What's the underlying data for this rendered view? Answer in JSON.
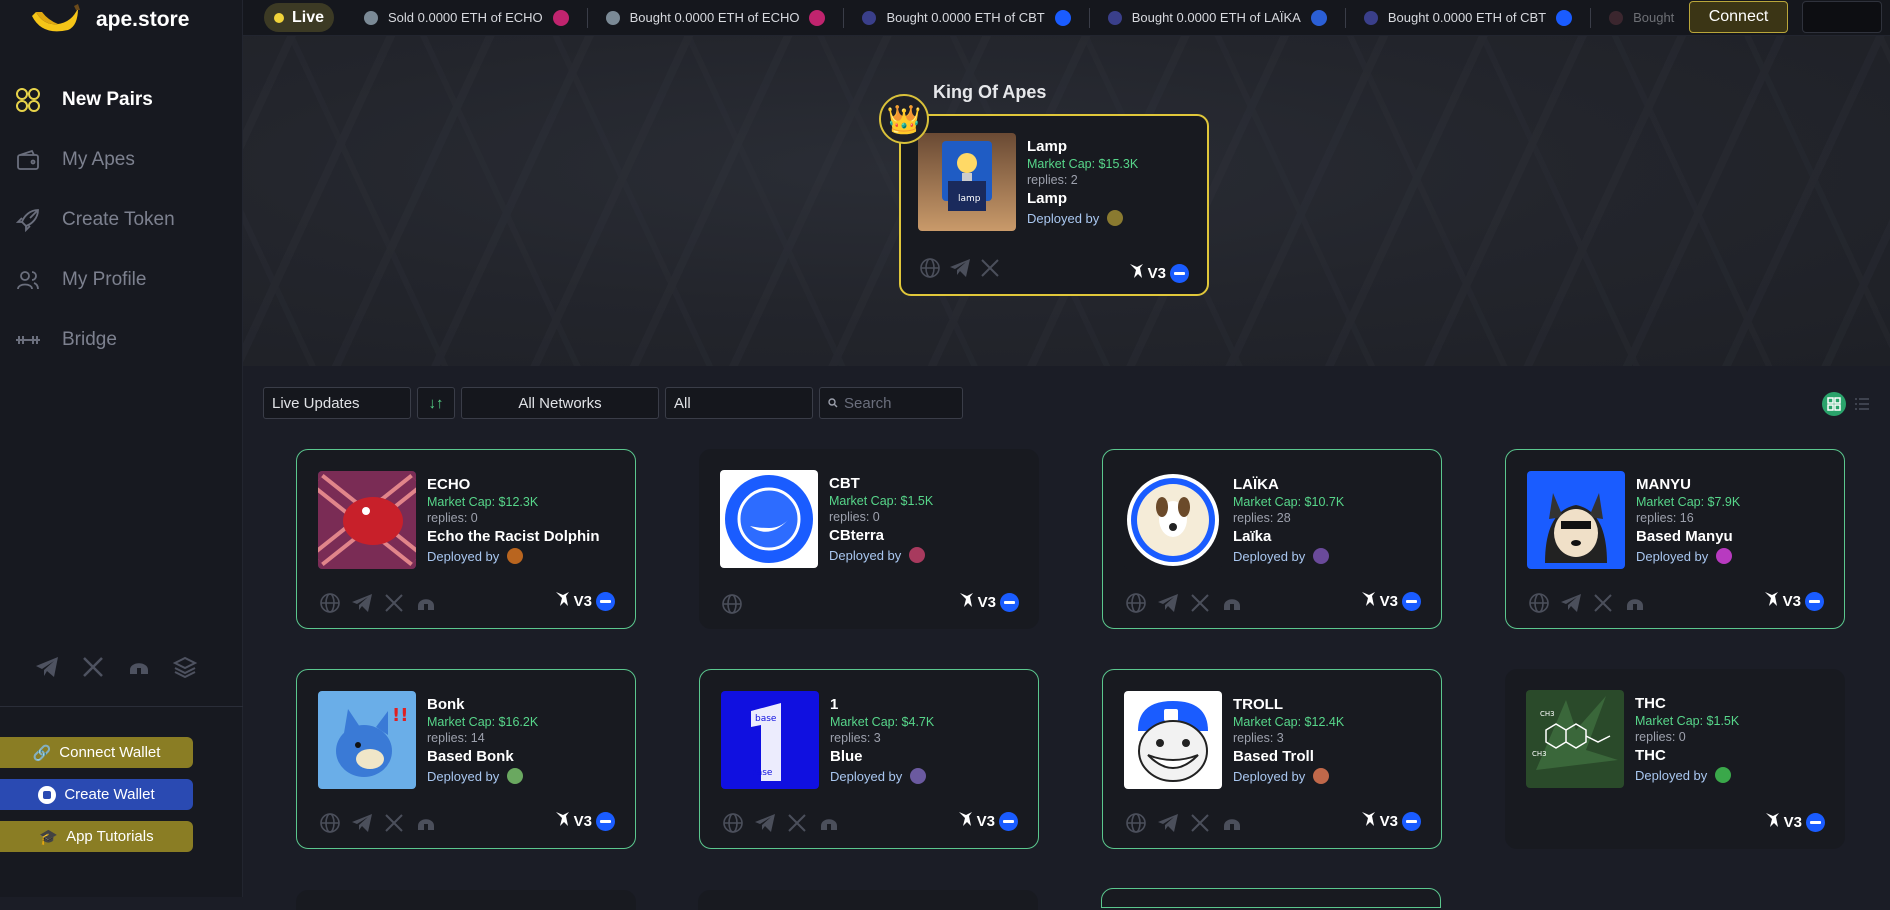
{
  "brand": {
    "name": "ape.store"
  },
  "nav": {
    "items": [
      {
        "label": "New Pairs",
        "icon": "grid-circles-icon",
        "active": true
      },
      {
        "label": "My Apes",
        "icon": "wallet-icon",
        "active": false
      },
      {
        "label": "Create Token",
        "icon": "rocket-icon",
        "active": false
      },
      {
        "label": "My Profile",
        "icon": "users-icon",
        "active": false
      },
      {
        "label": "Bridge",
        "icon": "bridge-icon",
        "active": false
      }
    ]
  },
  "sidebar": {
    "socials": [
      "telegram-icon",
      "x-icon",
      "helmet-icon",
      "book-icon"
    ],
    "connect_wallet": "Connect Wallet",
    "create_wallet": "Create Wallet",
    "app_tutorials": "App Tutorials"
  },
  "topbar": {
    "live": "Live",
    "ticker": [
      {
        "text": "Sold 0.0000 ETH of ECHO",
        "dot": "#7b8a96",
        "logo": "#c0246e"
      },
      {
        "text": "Bought 0.0000 ETH of ECHO",
        "dot": "#7b8a96",
        "logo": "#c0246e"
      },
      {
        "text": "Bought 0.0000 ETH of CBT",
        "dot": "#3a3f8a",
        "logo": "#1a5cff"
      },
      {
        "text": "Bought 0.0000 ETH of LAÏKA",
        "dot": "#3a3f8a",
        "logo": "#2b5fd6"
      },
      {
        "text": "Bought 0.0000 ETH of CBT",
        "dot": "#3a3f8a",
        "logo": "#1a5cff"
      },
      {
        "text": "Bought",
        "dot": "#6b3a44",
        "logo": "#1a5cff"
      }
    ],
    "connect": "Connect"
  },
  "king": {
    "title": "King Of Apes",
    "ticker": "Lamp",
    "market_cap": "Market Cap: $15.3K",
    "replies": "replies: 2",
    "name": "Lamp",
    "deployed_by": "Deployed by",
    "version": "V3"
  },
  "filters": {
    "sort": "Live Updates",
    "sort_dir": "↓↑",
    "networks": "All Networks",
    "category": "All",
    "search_placeholder": "Search"
  },
  "cards": [
    {
      "ticker": "ECHO",
      "market_cap": "Market Cap: $12.3K",
      "replies": "replies: 0",
      "name": "Echo the Racist Dolphin",
      "deployed_by": "Deployed by",
      "version": "V3",
      "bordered": true
    },
    {
      "ticker": "CBT",
      "market_cap": "Market Cap: $1.5K",
      "replies": "replies: 0",
      "name": "CBterra",
      "deployed_by": "Deployed by",
      "version": "V3",
      "bordered": false
    },
    {
      "ticker": "LAÏKA",
      "market_cap": "Market Cap: $10.7K",
      "replies": "replies: 28",
      "name": "Laïka",
      "deployed_by": "Deployed by",
      "version": "V3",
      "bordered": true
    },
    {
      "ticker": "MANYU",
      "market_cap": "Market Cap: $7.9K",
      "replies": "replies: 16",
      "name": "Based Manyu",
      "deployed_by": "Deployed by",
      "version": "V3",
      "bordered": true
    },
    {
      "ticker": "Bonk",
      "market_cap": "Market Cap: $16.2K",
      "replies": "replies: 14",
      "name": "Based Bonk",
      "deployed_by": "Deployed by",
      "version": "V3",
      "bordered": true
    },
    {
      "ticker": "1",
      "market_cap": "Market Cap: $4.7K",
      "replies": "replies: 3",
      "name": "Blue",
      "deployed_by": "Deployed by",
      "version": "V3",
      "bordered": true
    },
    {
      "ticker": "TROLL",
      "market_cap": "Market Cap: $12.4K",
      "replies": "replies: 3",
      "name": "Based Troll",
      "deployed_by": "Deployed by",
      "version": "V3",
      "bordered": true
    },
    {
      "ticker": "THC",
      "market_cap": "Market Cap: $1.5K",
      "replies": "replies: 0",
      "name": "THC",
      "deployed_by": "Deployed by",
      "version": "V3",
      "bordered": false
    }
  ],
  "colors": {
    "accent": "#e0c73a",
    "green": "#57d68a",
    "blue": "#1a5cff"
  }
}
